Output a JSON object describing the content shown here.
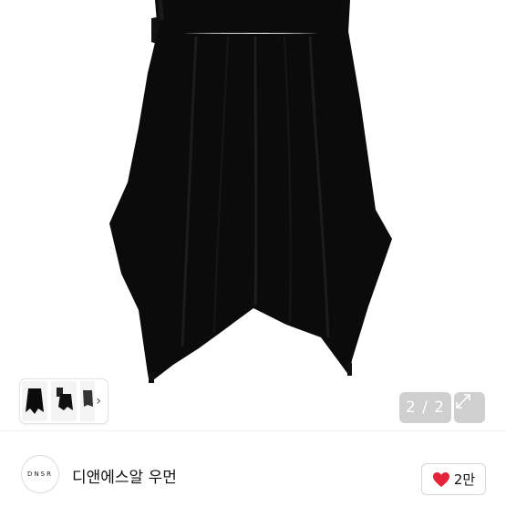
{
  "gallery": {
    "counter": "2 / 2",
    "thumb_chevron": "›"
  },
  "seller": {
    "logo_text": "DNSR",
    "shop_name": "디앤에스알 우먼"
  },
  "like": {
    "count": "2만"
  },
  "colors": {
    "heart": "#e5243b",
    "overlay_button": "#cfcfcf",
    "skirt": "#0b0b0b"
  },
  "icons": {
    "expand": "expand-arrows-icon",
    "like": "heart-icon",
    "thumb_next": "chevron-right-icon"
  }
}
